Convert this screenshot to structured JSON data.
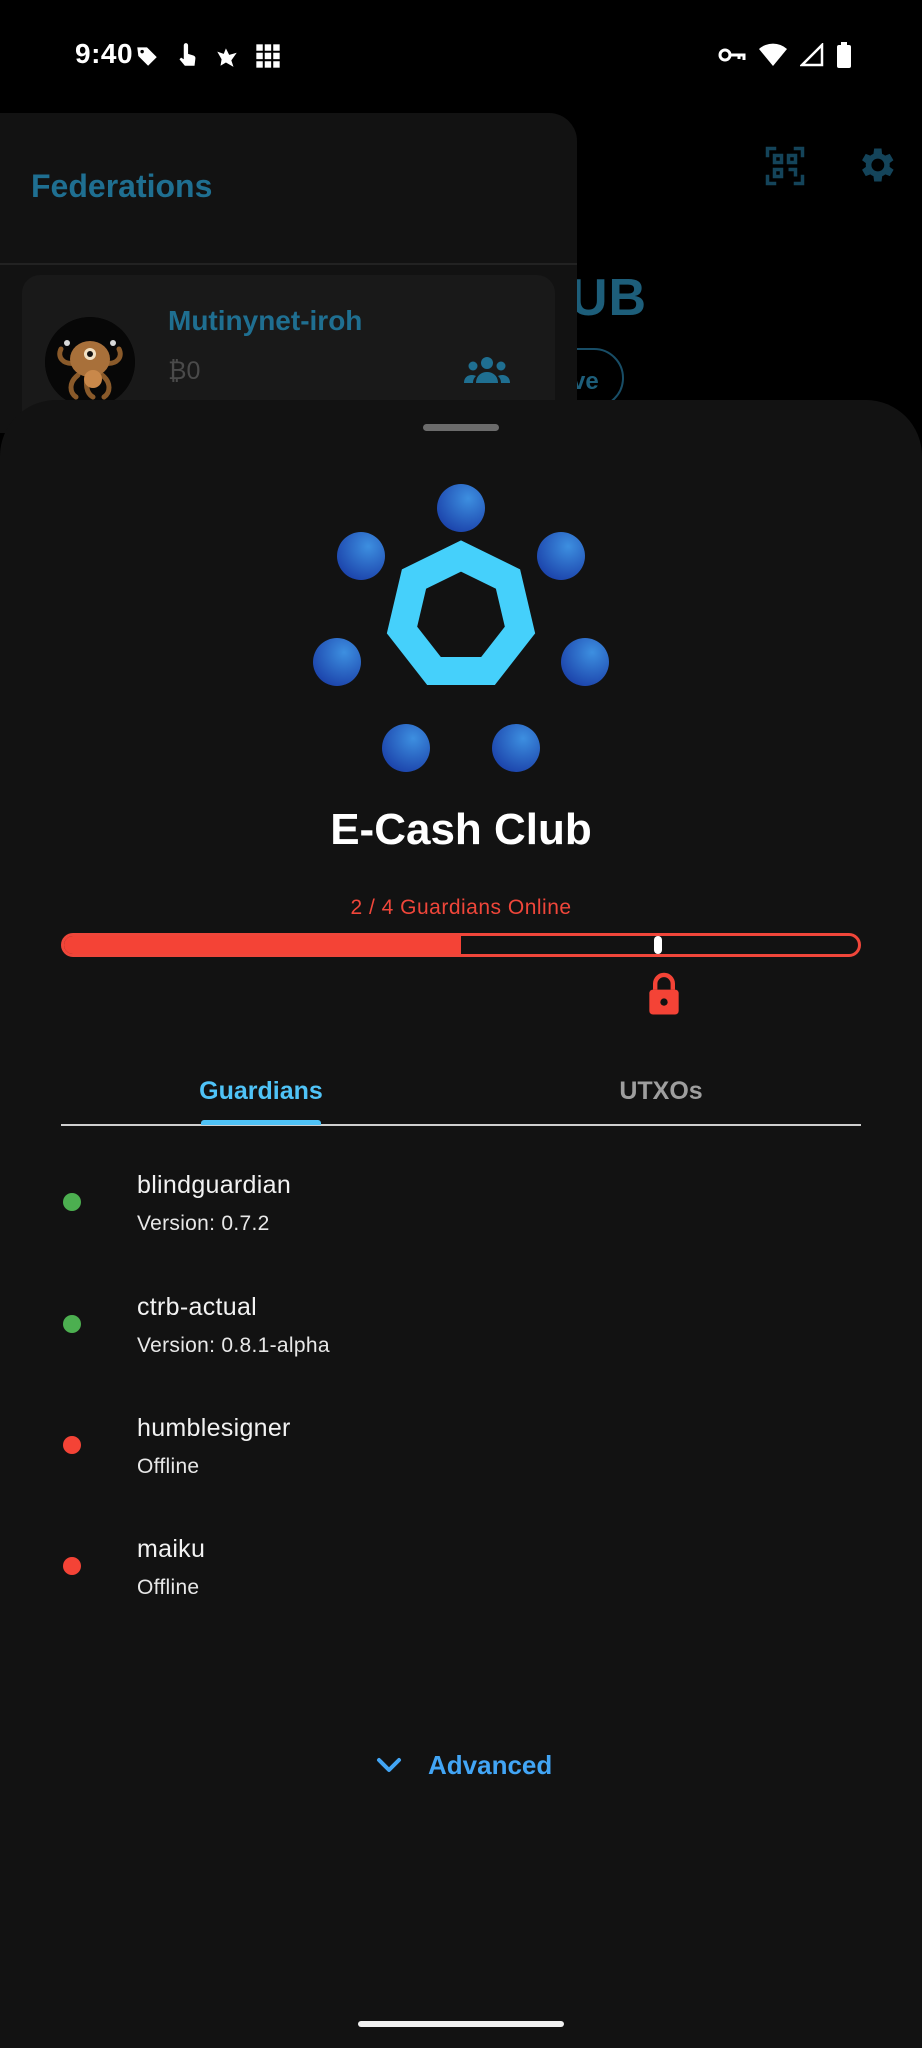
{
  "status_bar": {
    "time": "9:40",
    "icons": [
      "tag-icon",
      "touch-icon",
      "bird-icon",
      "grid-icon",
      "vpn-key-icon",
      "wifi-icon",
      "cellular-signal-icon",
      "battery-icon"
    ]
  },
  "background": {
    "drawer_title": "Federations",
    "federation": {
      "name": "Mutinynet-iroh",
      "balance": "₿0"
    },
    "title_fragment": "UB",
    "button_fragment": "ve",
    "icons": [
      "qr-scan-icon",
      "gear-icon",
      "group-icon"
    ]
  },
  "sheet": {
    "federation_name": "E-Cash Club",
    "guardians_online_text": "2 / 4 Guardians Online",
    "online_count": 2,
    "total_guardians": 4,
    "online_fraction": 0.5,
    "threshold_fraction": 0.75,
    "tabs": [
      {
        "label": "Guardians",
        "active": true
      },
      {
        "label": "UTXOs",
        "active": false
      }
    ],
    "guardians": [
      {
        "name": "blindguardian",
        "status": "Version: 0.7.2",
        "online": true
      },
      {
        "name": "ctrb-actual",
        "status": "Version: 0.8.1-alpha",
        "online": true
      },
      {
        "name": "humblesigner",
        "status": "Offline",
        "online": false
      },
      {
        "name": "maiku",
        "status": "Offline",
        "online": false
      }
    ],
    "advanced_label": "Advanced"
  },
  "colors": {
    "online": "#4caf50",
    "offline": "#f44336",
    "accent": "#4fc3f7",
    "link": "#42a5f5",
    "warning": "#f0463a"
  }
}
